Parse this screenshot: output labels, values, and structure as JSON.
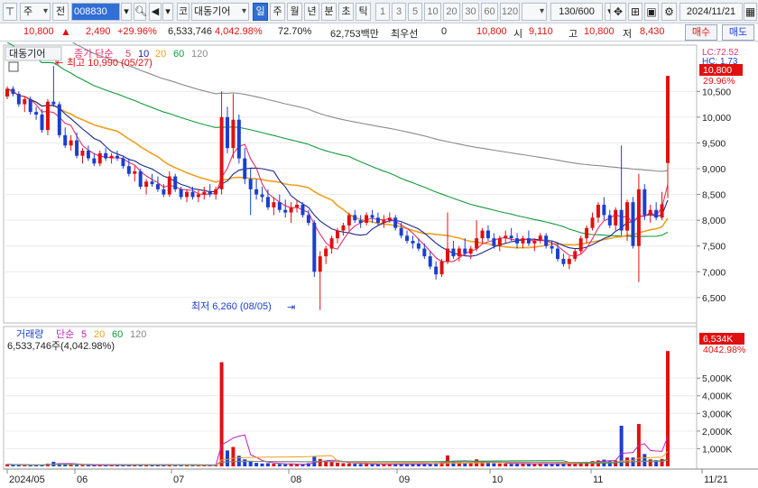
{
  "toolbar": {
    "market": "주",
    "prev": "전",
    "code": "008830",
    "name_type": "코",
    "stock_name": "대동기어",
    "periods": [
      "일",
      "주",
      "월",
      "년",
      "분",
      "초",
      "틱"
    ],
    "active_period": "일",
    "minute_buttons": [
      "1",
      "3",
      "5",
      "10",
      "20",
      "30",
      "60",
      "120"
    ],
    "count": "130/600",
    "date": "2024/11/21"
  },
  "quote": {
    "price": "10,800",
    "change": "2,490",
    "change_pct": "+29.96%",
    "volume": "6,533,746",
    "volume_pct": "4,042.98%",
    "turnover_pct": "72.70%",
    "amount": "62,753백만",
    "priority": "최우선",
    "priority_val": "0",
    "bid": "10,800",
    "open_label": "시",
    "open": "9,110",
    "high_label": "고",
    "high": "10,800",
    "low_label": "저",
    "low": "8,430",
    "buy": "매수",
    "sell": "매도"
  },
  "price_panel": {
    "tag": "대동기어",
    "legend_title": "종가 단순",
    "ma_periods": [
      "5",
      "10",
      "20",
      "60",
      "120"
    ],
    "ma_colors": [
      "#e0306e",
      "#1b2a8c",
      "#f0a020",
      "#139b3a",
      "#8a8a8a"
    ],
    "high_mark": "최고 10,990 (05/27)",
    "low_mark": "최저 6,260 (08/05)",
    "lc": "LC:72.52",
    "hc": "HC: 1.73",
    "last_price": "10,800",
    "last_pct": "29.96%",
    "y_ticks": [
      "10,500",
      "10,000",
      "9,500",
      "9,000",
      "8,500",
      "8,000",
      "7,500",
      "7,000",
      "6,500"
    ]
  },
  "volume_panel": {
    "title": "거래량",
    "ma_label": "단순",
    "ma_periods": [
      "5",
      "20",
      "60",
      "120"
    ],
    "ma_colors": [
      "#c020c0",
      "#f0a020",
      "#139b3a",
      "#8a8a8a"
    ],
    "info": "6,533,746주(4,042.98%)",
    "last": "6,534K",
    "last_pct": "4042.98%",
    "y_ticks": [
      "5,000K",
      "4,000K",
      "3,000K",
      "2,000K",
      "1,000K"
    ]
  },
  "x_axis": {
    "labels": [
      "2024/05",
      "06",
      "07",
      "08",
      "09",
      "10",
      "11",
      "11/21"
    ]
  },
  "colors": {
    "up": "#e01010",
    "down": "#1a3fd0",
    "accent": "#2f6fd6"
  },
  "chart_data": {
    "type": "candlestick",
    "price_unit": "KRW",
    "ylim": [
      6200,
      11100
    ],
    "ohlc": [
      [
        10400,
        10600,
        10350,
        10550
      ],
      [
        10550,
        10600,
        10400,
        10450
      ],
      [
        10450,
        10500,
        10200,
        10250
      ],
      [
        10250,
        10400,
        10100,
        10350
      ],
      [
        10350,
        10400,
        10050,
        10100
      ],
      [
        10100,
        10200,
        9950,
        10050
      ],
      [
        10050,
        10150,
        9700,
        9750
      ],
      [
        9750,
        10350,
        9650,
        10300
      ],
      [
        10300,
        10990,
        10200,
        10250
      ],
      [
        10250,
        10300,
        9600,
        9650
      ],
      [
        9650,
        9800,
        9400,
        9450
      ],
      [
        9450,
        9650,
        9350,
        9550
      ],
      [
        9550,
        9700,
        9200,
        9250
      ],
      [
        9250,
        9400,
        9100,
        9350
      ],
      [
        9350,
        9450,
        9150,
        9200
      ],
      [
        9200,
        9300,
        9050,
        9100
      ],
      [
        9100,
        9350,
        9050,
        9300
      ],
      [
        9300,
        9400,
        9150,
        9200
      ],
      [
        9200,
        9300,
        9100,
        9250
      ],
      [
        9250,
        9350,
        9150,
        9200
      ],
      [
        9200,
        9250,
        9000,
        9050
      ],
      [
        9050,
        9200,
        8850,
        8900
      ],
      [
        8900,
        9050,
        8750,
        8950
      ],
      [
        8950,
        9000,
        8600,
        8650
      ],
      [
        8650,
        8800,
        8500,
        8750
      ],
      [
        8750,
        8900,
        8650,
        8700
      ],
      [
        8700,
        8850,
        8550,
        8600
      ],
      [
        8600,
        8700,
        8450,
        8500
      ],
      [
        8500,
        8950,
        8450,
        8850
      ],
      [
        8850,
        8900,
        8550,
        8600
      ],
      [
        8600,
        8650,
        8400,
        8450
      ],
      [
        8450,
        8600,
        8350,
        8550
      ],
      [
        8550,
        8650,
        8400,
        8450
      ],
      [
        8450,
        8600,
        8350,
        8500
      ],
      [
        8500,
        8650,
        8400,
        8550
      ],
      [
        8550,
        8700,
        8450,
        8500
      ],
      [
        8500,
        8650,
        8400,
        8600
      ],
      [
        8600,
        10500,
        8500,
        10000
      ],
      [
        10000,
        10200,
        9300,
        9400
      ],
      [
        9400,
        10450,
        9200,
        9950
      ],
      [
        9950,
        10050,
        9100,
        9200
      ],
      [
        9200,
        9400,
        8700,
        8800
      ],
      [
        8800,
        9000,
        8100,
        8600
      ],
      [
        8600,
        8800,
        8400,
        8500
      ],
      [
        8500,
        8650,
        8350,
        8450
      ],
      [
        8450,
        8600,
        8200,
        8250
      ],
      [
        8250,
        8450,
        8100,
        8350
      ],
      [
        8350,
        8500,
        8150,
        8200
      ],
      [
        8200,
        8400,
        8050,
        8150
      ],
      [
        8150,
        8350,
        7950,
        8250
      ],
      [
        8250,
        8400,
        8150,
        8300
      ],
      [
        8300,
        8350,
        8050,
        8100
      ],
      [
        8100,
        8200,
        7900,
        7950
      ],
      [
        7950,
        8000,
        6900,
        7000
      ],
      [
        7000,
        7400,
        6260,
        7300
      ],
      [
        7300,
        7500,
        7150,
        7450
      ],
      [
        7450,
        7700,
        7350,
        7650
      ],
      [
        7650,
        7850,
        7550,
        7800
      ],
      [
        7800,
        7950,
        7700,
        7900
      ],
      [
        7900,
        8150,
        7800,
        8100
      ],
      [
        8100,
        8200,
        7950,
        8000
      ],
      [
        8000,
        8100,
        7850,
        7950
      ],
      [
        7950,
        8150,
        7900,
        8100
      ],
      [
        8100,
        8200,
        7950,
        8050
      ],
      [
        8050,
        8150,
        7900,
        7950
      ],
      [
        7950,
        8100,
        7850,
        8000
      ],
      [
        8000,
        8150,
        7950,
        8050
      ],
      [
        8050,
        8100,
        7800,
        7850
      ],
      [
        7850,
        7950,
        7650,
        7700
      ],
      [
        7700,
        7800,
        7550,
        7600
      ],
      [
        7600,
        7700,
        7450,
        7550
      ],
      [
        7550,
        7650,
        7400,
        7450
      ],
      [
        7450,
        7550,
        7250,
        7300
      ],
      [
        7300,
        7400,
        7050,
        7100
      ],
      [
        7100,
        7200,
        6850,
        6950
      ],
      [
        6950,
        7250,
        6900,
        7200
      ],
      [
        7200,
        8150,
        7150,
        7450
      ],
      [
        7450,
        7600,
        7250,
        7300
      ],
      [
        7300,
        7500,
        7200,
        7450
      ],
      [
        7450,
        7650,
        7300,
        7350
      ],
      [
        7350,
        7500,
        7250,
        7450
      ],
      [
        7450,
        8000,
        7400,
        7650
      ],
      [
        7650,
        7850,
        7550,
        7800
      ],
      [
        7800,
        7900,
        7600,
        7650
      ],
      [
        7650,
        7750,
        7450,
        7500
      ],
      [
        7500,
        7700,
        7400,
        7650
      ],
      [
        7650,
        7800,
        7550,
        7700
      ],
      [
        7700,
        7850,
        7600,
        7650
      ],
      [
        7650,
        7750,
        7450,
        7550
      ],
      [
        7550,
        7700,
        7450,
        7650
      ],
      [
        7650,
        7800,
        7500,
        7550
      ],
      [
        7550,
        7650,
        7400,
        7600
      ],
      [
        7600,
        7750,
        7550,
        7700
      ],
      [
        7700,
        7750,
        7450,
        7500
      ],
      [
        7500,
        7600,
        7350,
        7450
      ],
      [
        7450,
        7550,
        7200,
        7250
      ],
      [
        7250,
        7350,
        7100,
        7150
      ],
      [
        7150,
        7300,
        7050,
        7250
      ],
      [
        7250,
        7450,
        7200,
        7400
      ],
      [
        7400,
        7700,
        7350,
        7650
      ],
      [
        7650,
        7900,
        7550,
        7850
      ],
      [
        7850,
        8150,
        7800,
        8050
      ],
      [
        8050,
        8350,
        7950,
        8300
      ],
      [
        8300,
        8450,
        8000,
        8100
      ],
      [
        8100,
        8200,
        7850,
        7900
      ],
      [
        7900,
        8250,
        7800,
        8200
      ],
      [
        8200,
        9450,
        7700,
        7800
      ],
      [
        7800,
        8400,
        7600,
        8350
      ],
      [
        8350,
        8450,
        7450,
        7500
      ],
      [
        7500,
        8900,
        6800,
        8600
      ],
      [
        8600,
        8700,
        8000,
        8100
      ],
      [
        8100,
        8300,
        7950,
        8200
      ],
      [
        8200,
        8350,
        8000,
        8050
      ],
      [
        8050,
        8550,
        8000,
        8310
      ],
      [
        9110,
        10800,
        8430,
        10800
      ]
    ],
    "volume_k": [
      120,
      80,
      90,
      70,
      60,
      75,
      90,
      150,
      260,
      180,
      110,
      90,
      80,
      70,
      65,
      60,
      70,
      60,
      55,
      60,
      70,
      80,
      90,
      75,
      60,
      55,
      50,
      60,
      120,
      80,
      70,
      60,
      55,
      50,
      60,
      55,
      60,
      5900,
      900,
      1100,
      600,
      400,
      300,
      200,
      160,
      180,
      150,
      130,
      120,
      140,
      110,
      100,
      180,
      550,
      420,
      300,
      250,
      200,
      180,
      170,
      150,
      130,
      140,
      120,
      110,
      115,
      120,
      140,
      150,
      130,
      120,
      130,
      150,
      170,
      190,
      210,
      620,
      300,
      220,
      200,
      180,
      400,
      260,
      200,
      170,
      160,
      150,
      140,
      150,
      160,
      140,
      130,
      150,
      160,
      140,
      150,
      140,
      160,
      180,
      220,
      260,
      300,
      340,
      380,
      300,
      330,
      2300,
      500,
      500,
      2400,
      700,
      400,
      350,
      420,
      6534
    ]
  }
}
